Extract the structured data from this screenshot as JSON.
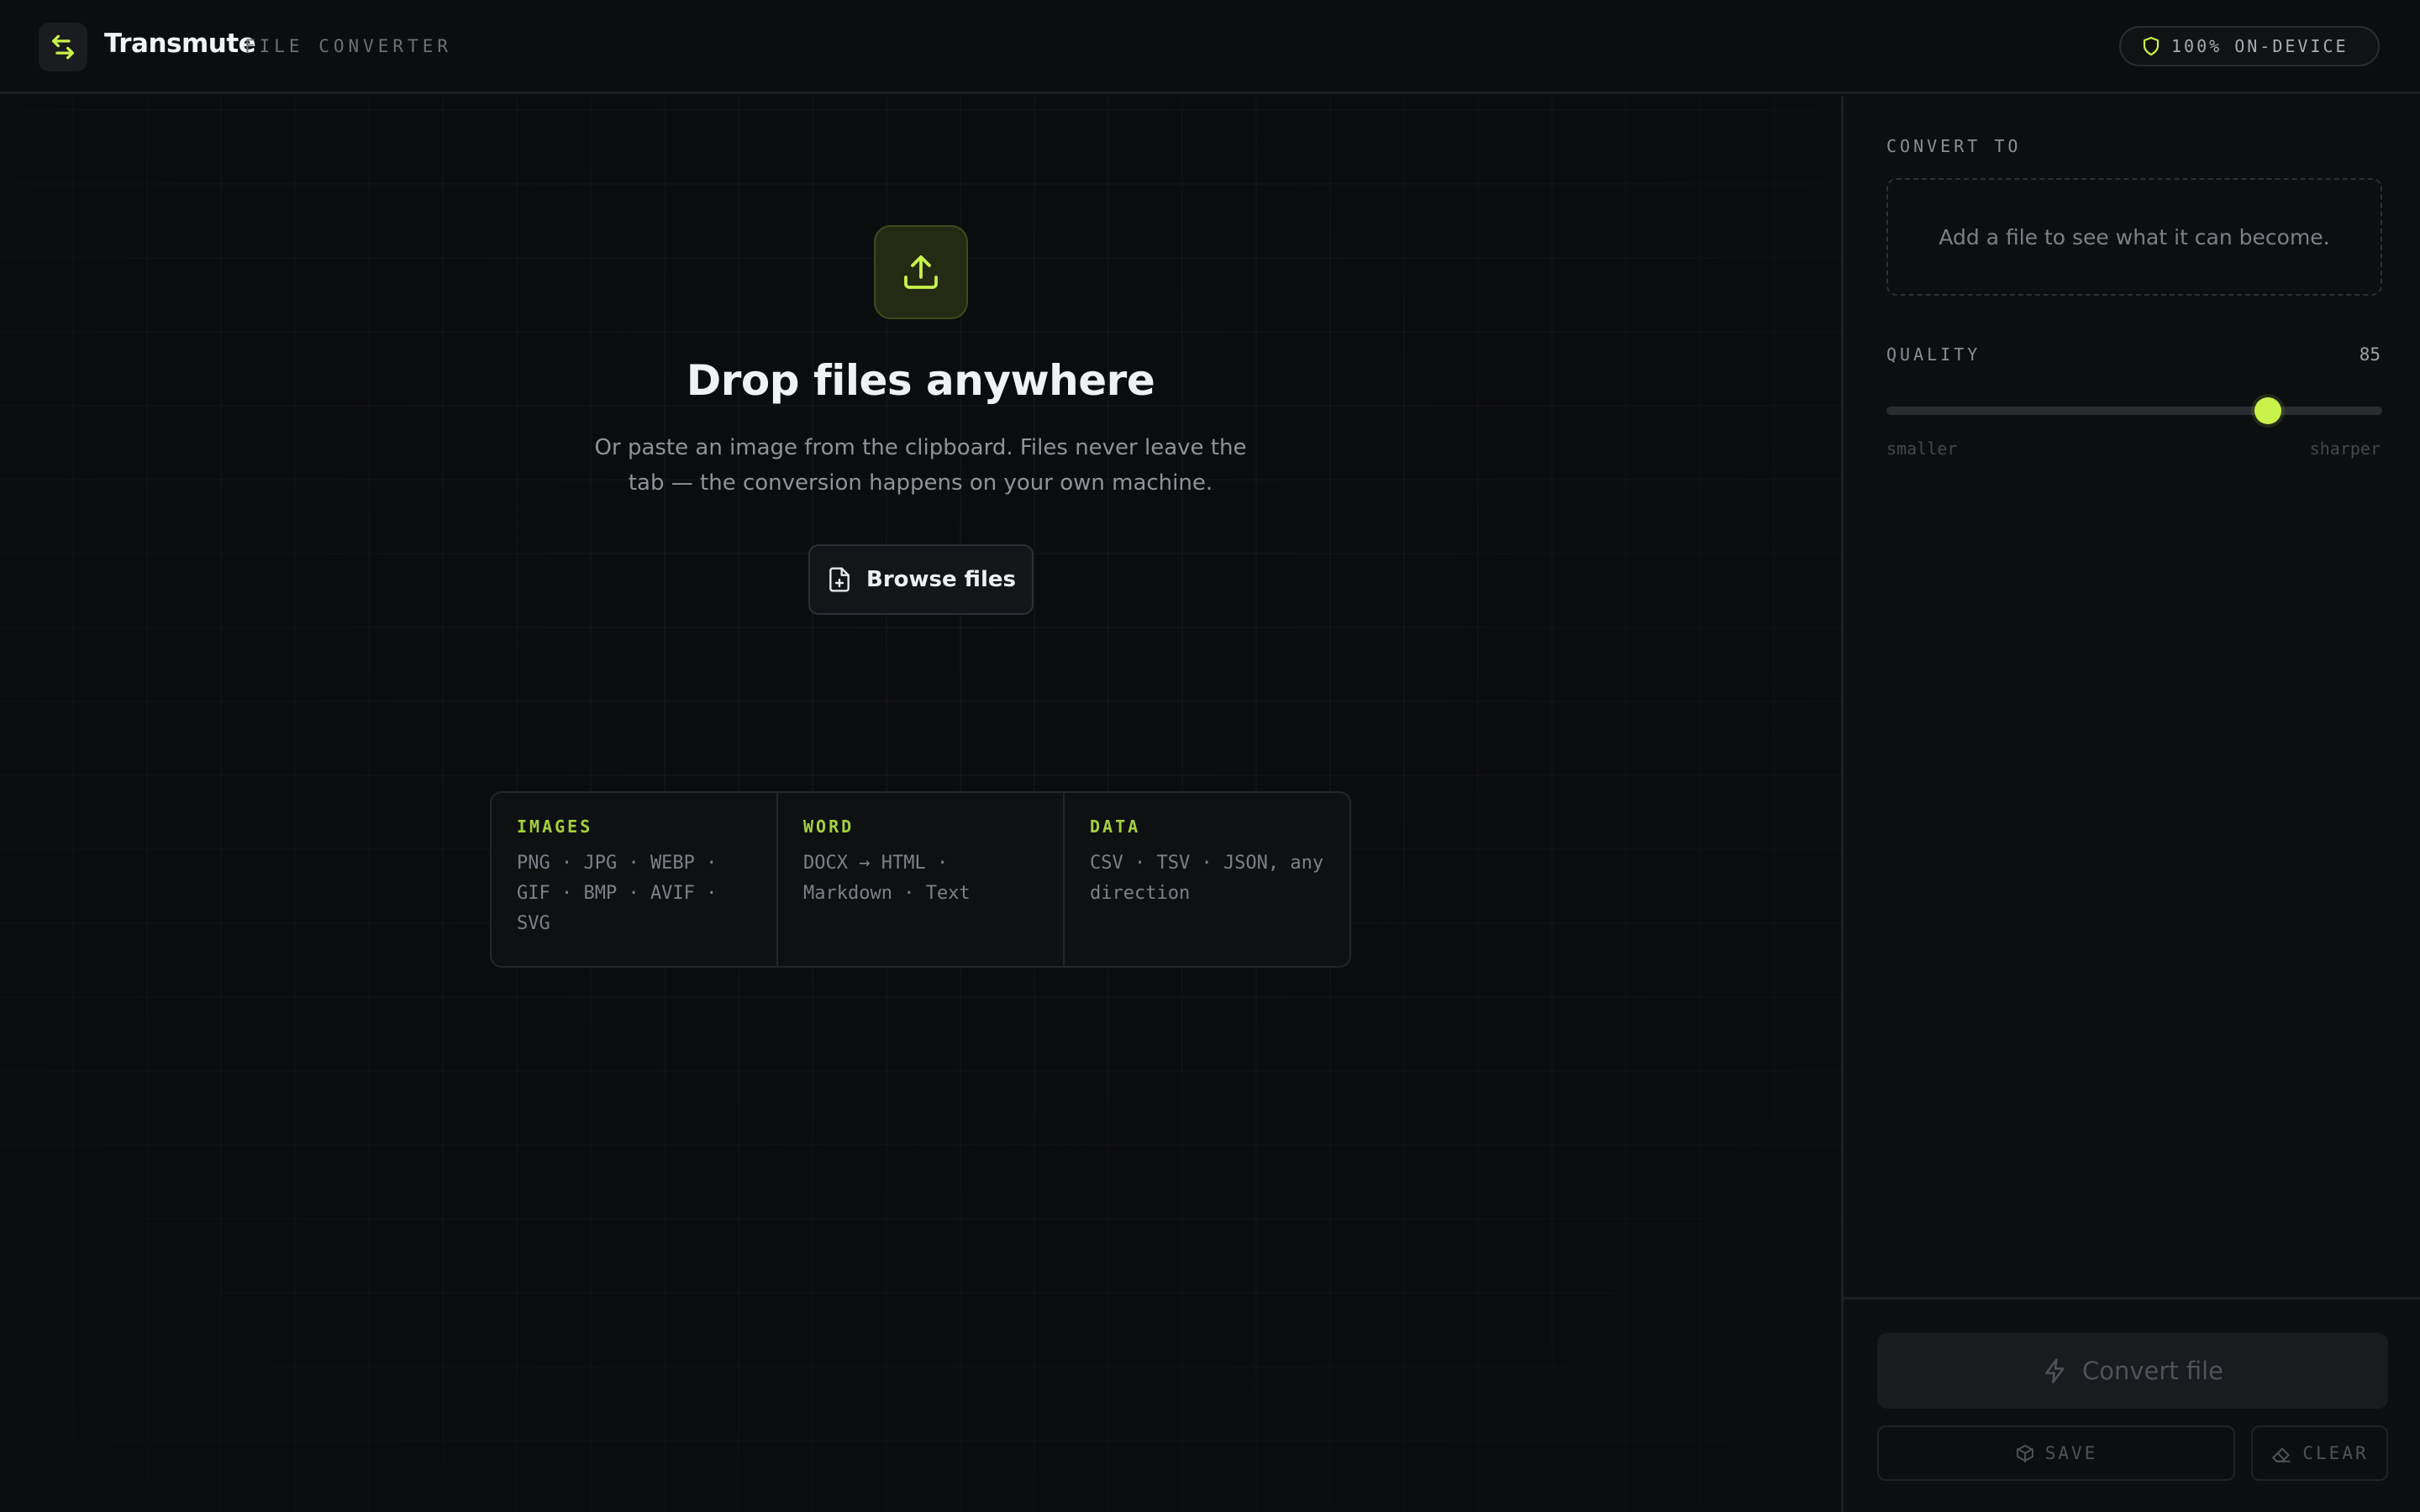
{
  "header": {
    "brand_name": "Transmute",
    "brand_sub": "FILE CONVERTER",
    "device_badge": "100% ON-DEVICE"
  },
  "dropzone": {
    "title": "Drop files anywhere",
    "description": "Or paste an image from the clipboard. Files never leave the tab — the conversion happens on your own machine.",
    "browse_label": "Browse files"
  },
  "formats": [
    {
      "heading": "IMAGES",
      "items": "PNG · JPG · WEBP · GIF · BMP · AVIF · SVG"
    },
    {
      "heading": "WORD",
      "items": "DOCX → HTML · Markdown · Text"
    },
    {
      "heading": "DATA",
      "items": "CSV · TSV · JSON, any direction"
    }
  ],
  "sidebar": {
    "convert_to_label": "CONVERT TO",
    "convert_to_empty": "Add a file to see what it can become.",
    "quality_label": "QUALITY",
    "quality_value": "85",
    "quality_fraction": 0.77,
    "quality_low_label": "smaller",
    "quality_high_label": "sharper",
    "convert_button": "Convert file",
    "save_button": "SAVE",
    "clear_button": "CLEAR"
  },
  "colors": {
    "accent": "#c9f24a",
    "accent_text": "#a3d13a",
    "background": "#0b0c0e"
  },
  "icons": {
    "logo": "swap-arrows-icon",
    "device": "shield-icon",
    "upload": "upload-icon",
    "browse": "file-plus-icon",
    "convert": "lightning-icon",
    "save": "box-icon",
    "clear": "eraser-icon"
  }
}
